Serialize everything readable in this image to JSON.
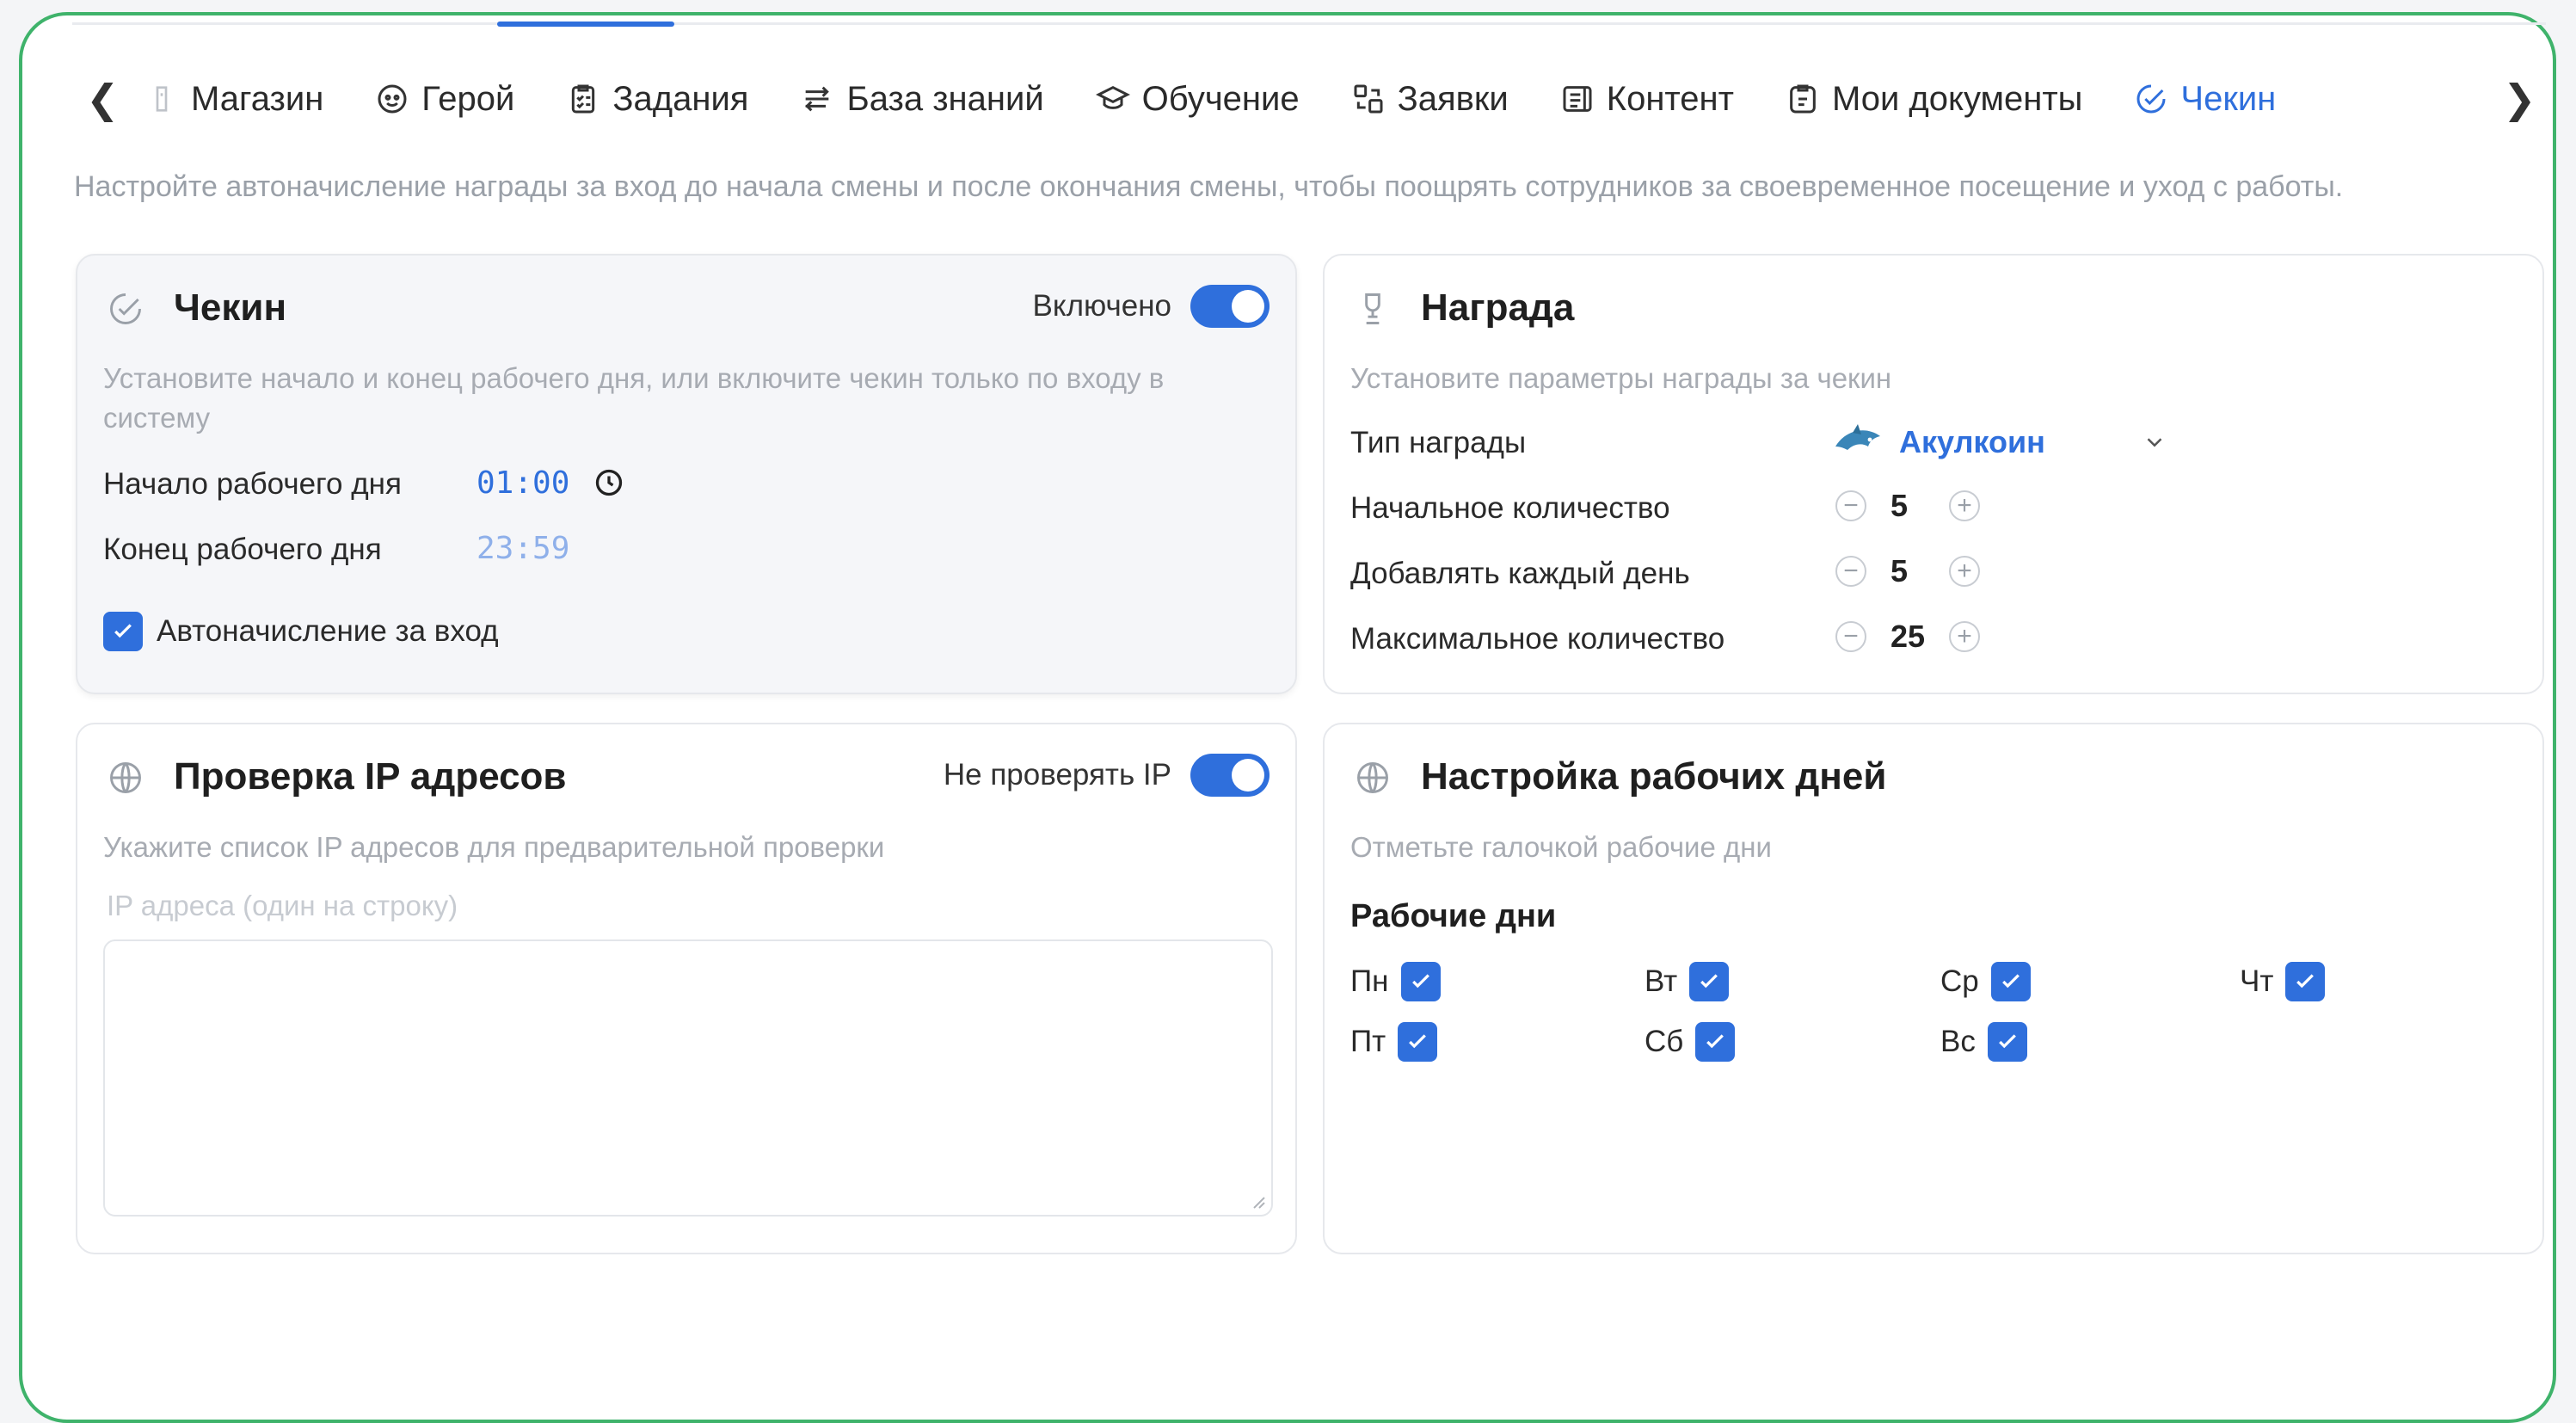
{
  "tabs": [
    {
      "label": "Магазин",
      "icon": "shop-icon"
    },
    {
      "label": "Герой",
      "icon": "hero-icon"
    },
    {
      "label": "Задания",
      "icon": "tasks-icon"
    },
    {
      "label": "База знаний",
      "icon": "knowledge-base-icon"
    },
    {
      "label": "Обучение",
      "icon": "education-icon"
    },
    {
      "label": "Заявки",
      "icon": "requests-icon"
    },
    {
      "label": "Контент",
      "icon": "content-icon"
    },
    {
      "label": "Мои документы",
      "icon": "documents-icon"
    },
    {
      "label": "Чекин",
      "icon": "checkin-icon",
      "active": true
    }
  ],
  "description": "Настройте автоначисление награды за вход до начала смены и после окончания смены, чтобы поощрять сотрудников за своевременное посещение и уход с работы.",
  "checkin": {
    "title": "Чекин",
    "toggle_label": "Включено",
    "subtitle": "Установите начало и конец рабочего дня, или включите чекин только по входу в систему",
    "start_label": "Начало рабочего дня",
    "start_time": "01:00",
    "end_label": "Конец рабочего дня",
    "end_time": "23:59",
    "auto_label": "Автоначисление за вход"
  },
  "reward": {
    "title": "Награда",
    "subtitle": "Установите параметры награды за чекин",
    "type_label": "Тип награды",
    "type_value": "Акулкоин",
    "initial_label": "Начальное количество",
    "initial_value": "5",
    "daily_label": "Добавлять каждый день",
    "daily_value": "5",
    "max_label": "Максимальное количество",
    "max_value": "25"
  },
  "ip": {
    "title": "Проверка IP адресов",
    "toggle_label": "Не проверять IP",
    "subtitle": "Укажите список IP адресов для предварительной проверки",
    "placeholder": "IP адреса (один на строку)"
  },
  "workdays": {
    "title": "Настройка рабочих дней",
    "subtitle": "Отметьте галочкой рабочие дни",
    "section_label": "Рабочие дни",
    "days": [
      "Пн",
      "Вт",
      "Ср",
      "Чт",
      "Пт",
      "Сб",
      "Вс"
    ]
  },
  "colors": {
    "accent": "#2f6fdc",
    "frame": "#3fb36b"
  }
}
